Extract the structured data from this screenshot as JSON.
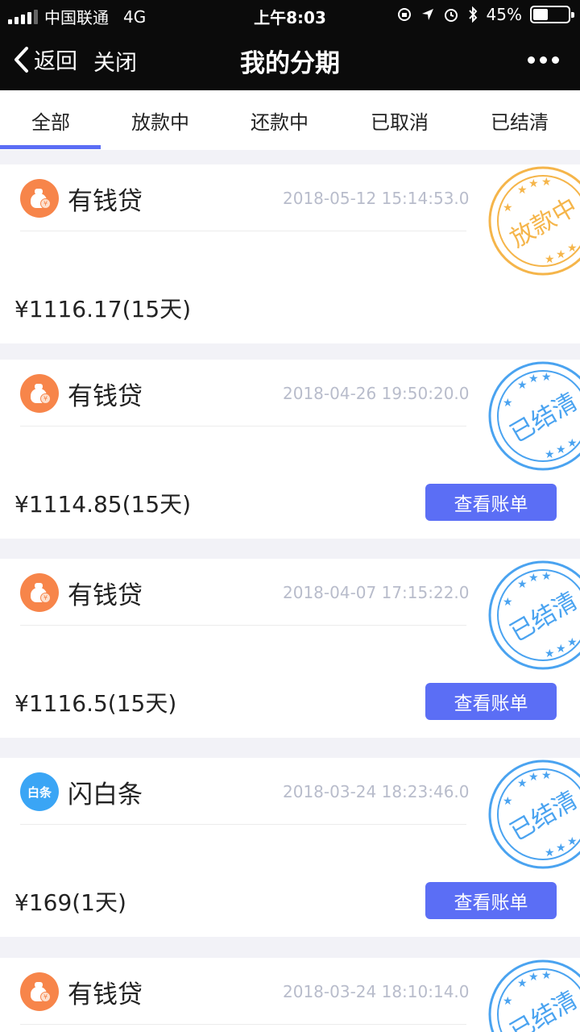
{
  "status_bar": {
    "carrier": "中国联通",
    "network": "4G",
    "time": "上午8:03",
    "battery": "45%"
  },
  "nav": {
    "back_label": "返回",
    "close_label": "关闭",
    "title": "我的分期"
  },
  "tabs": [
    {
      "label": "全部",
      "active": true
    },
    {
      "label": "放款中",
      "active": false
    },
    {
      "label": "还款中",
      "active": false
    },
    {
      "label": "已取消",
      "active": false
    },
    {
      "label": "已结清",
      "active": false
    }
  ],
  "colors": {
    "accent": "#5b6ef5",
    "stamp_orange": "#f5b54a",
    "stamp_blue": "#4aa3f0",
    "icon_orange": "#f7854a",
    "icon_blue": "#3aa5f5"
  },
  "loans": [
    {
      "name": "有钱贷",
      "icon": "money-bag-icon",
      "date": "2018-05-12 15:14:53.0",
      "amount": "¥1116.17(15天)",
      "status": "放款中",
      "stamp_color": "orange",
      "show_button": false
    },
    {
      "name": "有钱贷",
      "icon": "money-bag-icon",
      "date": "2018-04-26 19:50:20.0",
      "amount": "¥1114.85(15天)",
      "status": "已结清",
      "stamp_color": "blue",
      "show_button": true
    },
    {
      "name": "有钱贷",
      "icon": "money-bag-icon",
      "date": "2018-04-07 17:15:22.0",
      "amount": "¥1116.5(15天)",
      "status": "已结清",
      "stamp_color": "blue",
      "show_button": true
    },
    {
      "name": "闪白条",
      "icon": "baitiao-icon",
      "icon_text": "白条",
      "date": "2018-03-24 18:23:46.0",
      "amount": "¥169(1天)",
      "status": "已结清",
      "stamp_color": "blue",
      "show_button": true
    },
    {
      "name": "有钱贷",
      "icon": "money-bag-icon",
      "date": "2018-03-24 18:10:14.0",
      "amount": "",
      "status": "已结清",
      "stamp_color": "blue",
      "show_button": false
    }
  ],
  "bill_button_label": "查看账单",
  "coin_symbol": "¥"
}
